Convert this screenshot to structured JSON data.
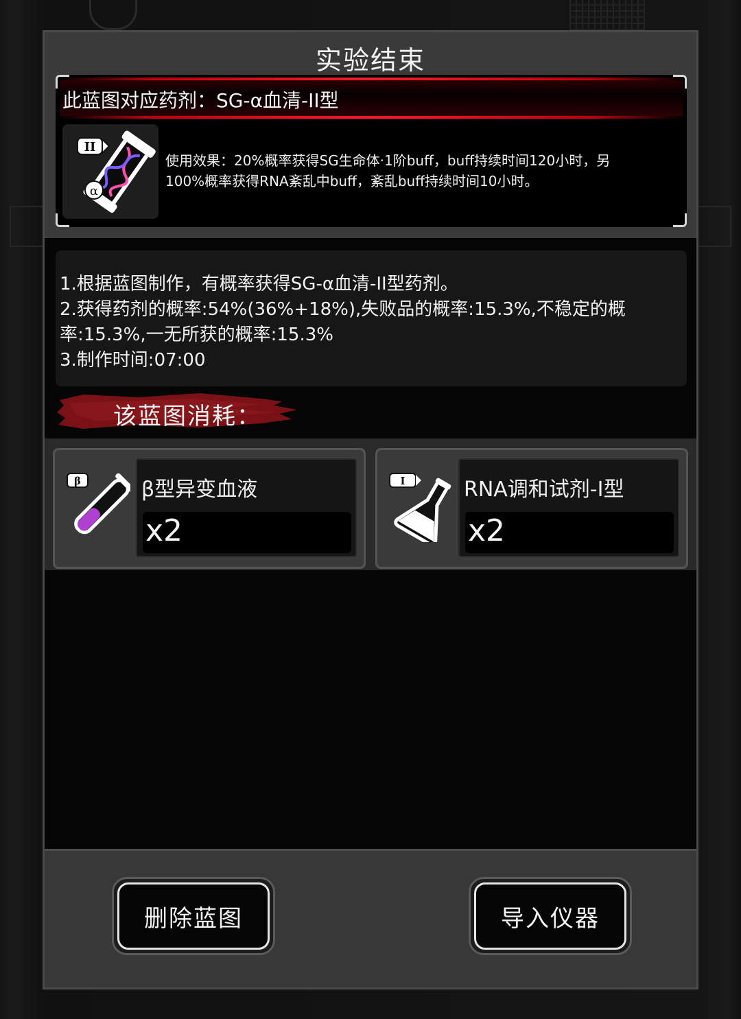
{
  "dialog": {
    "title": "实验结束",
    "blueprint_heading": "此蓝图对应药剂：SG-α血清-II型",
    "item_badge": "II",
    "effect_lines": [
      "使用效果：20%概率获得SG生命体·1阶buff，buff持续时间120小时，另",
      "100%概率获得RNA紊乱中buff，紊乱buff持续时间10小时。"
    ],
    "description_lines": [
      "1.根据蓝图制作，有概率获得SG-α血清-II型药剂。",
      "2.获得药剂的概率:54%(36%+18%),失败品的概率:15.3%,不稳定的概",
      "率:15.3%,一无所获的概率:15.3%",
      "3.制作时间:07:00"
    ],
    "consume_label": "该蓝图消耗：",
    "materials": [
      {
        "name": "β型异变血液",
        "qty": "x2",
        "badge": "β",
        "icon": "test-tube-icon"
      },
      {
        "name": "RNA调和试剂-I型",
        "qty": "x2",
        "badge": "I",
        "icon": "flask-icon"
      }
    ],
    "buttons": {
      "delete": "删除蓝图",
      "import": "导入仪器"
    }
  },
  "colors": {
    "accent_red": "#ff1a2a",
    "liquid_purple": "#b040d0"
  }
}
